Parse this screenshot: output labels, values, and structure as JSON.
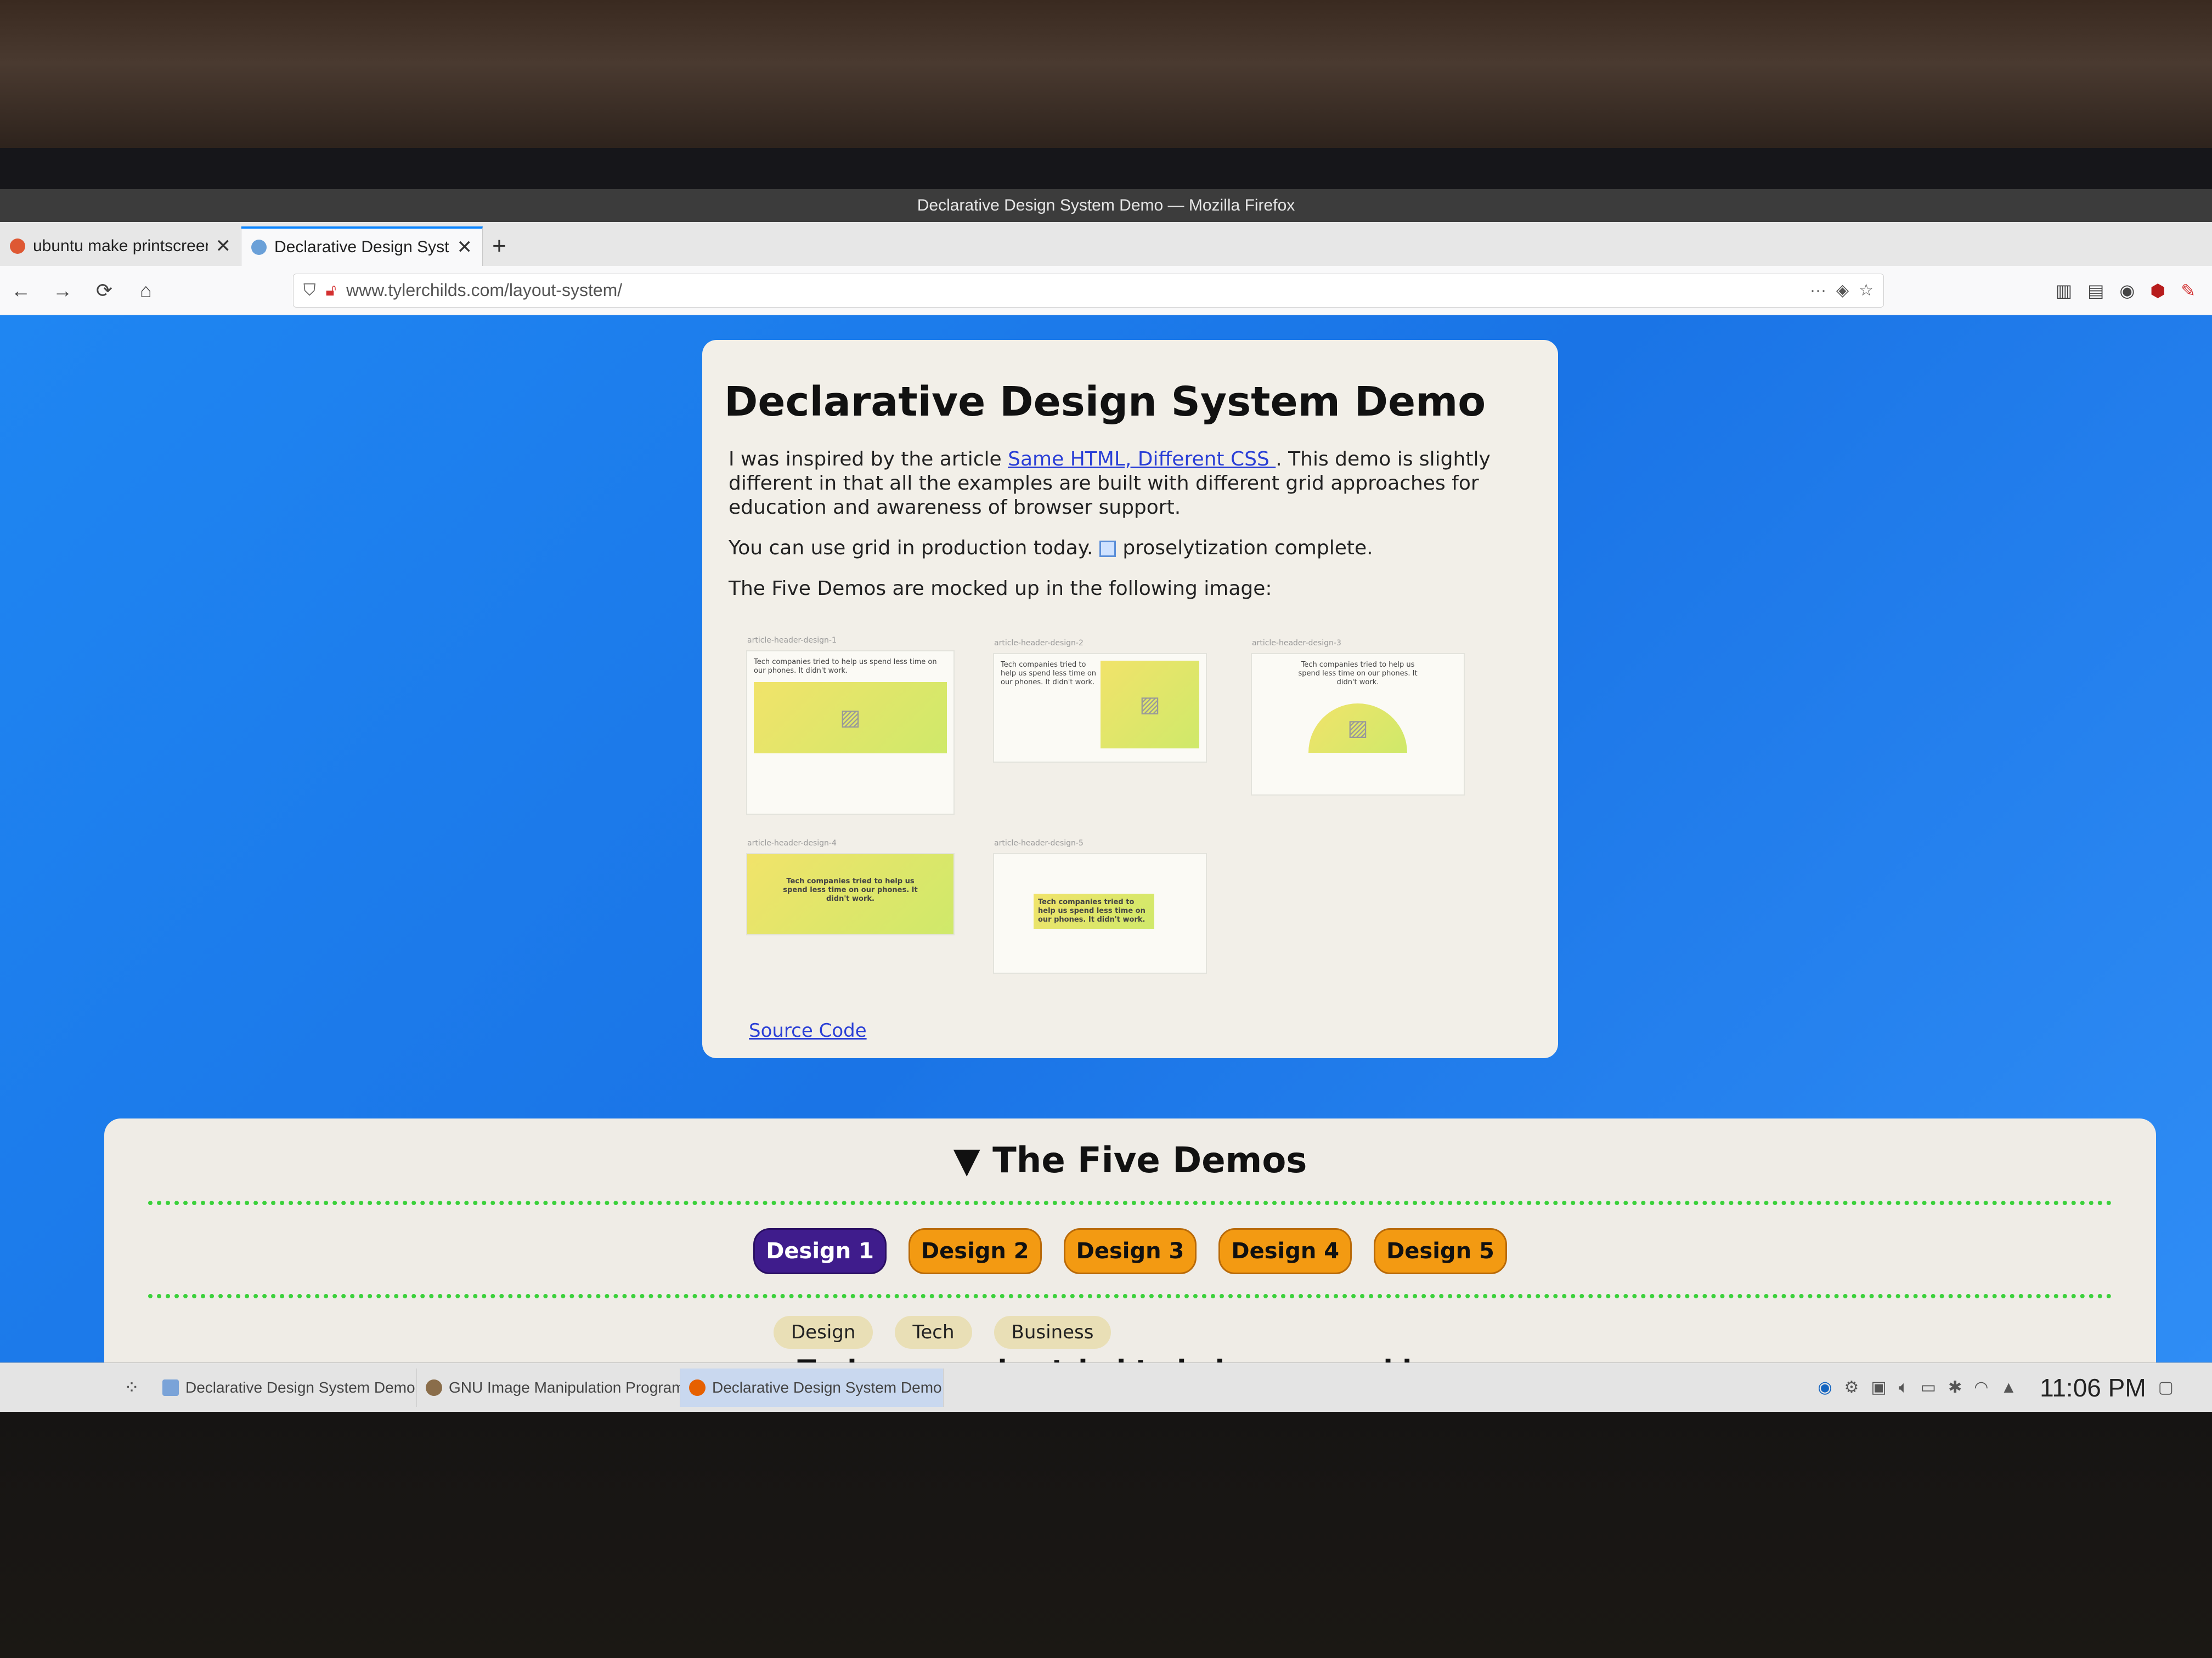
{
  "window": {
    "title": "Declarative Design System Demo — Mozilla Firefox"
  },
  "tabs": [
    {
      "label": "ubuntu make printscreen",
      "close": "✕",
      "active": false
    },
    {
      "label": "Declarative Design Syste",
      "close": "✕",
      "active": true
    }
  ],
  "new_tab": "+",
  "nav": {
    "back": "←",
    "forward": "→",
    "reload": "⟳",
    "home": "⌂"
  },
  "address": {
    "url": "www.tylerchilds.com/layout-system/",
    "more": "···"
  },
  "page": {
    "title": "Declarative Design System Demo",
    "intro_before": "I was inspired by the article ",
    "intro_link": "Same HTML, Different CSS ",
    "intro_after": ". This demo is slightly different in that all the examples are built with different grid approaches for education and awareness of browser support.",
    "grid_before": "You can use grid in production today.",
    "grid_after": "proselytization complete.",
    "mock_intro": "The Five Demos are mocked up in the following image:",
    "source_link": "Source Code"
  },
  "mock": {
    "labels": [
      "article-header-design-1",
      "article-header-design-2",
      "article-header-design-3",
      "article-header-design-4",
      "article-header-design-5"
    ],
    "headline": "Tech companies tried to help us spend less time on our phones. It didn't work."
  },
  "demos": {
    "heading": "▼ The Five Demos",
    "buttons": [
      "Design 1",
      "Design 2",
      "Design 3",
      "Design 4",
      "Design 5"
    ],
    "active_index": 0,
    "tags": [
      "Design",
      "Tech",
      "Business"
    ],
    "headline": "Tech companies tried to help us spend less"
  },
  "taskbar": {
    "items": [
      "Declarative Design System Demo ...",
      "GNU Image Manipulation Program",
      "Declarative Design System Demo ..."
    ],
    "clock": "11:06 PM"
  },
  "colors": {
    "page_bg": "#1a74e6",
    "accent": "#0a84ff",
    "active_button": "#3f1c8c",
    "button": "#f39a12",
    "dots": "#3bd13b"
  }
}
